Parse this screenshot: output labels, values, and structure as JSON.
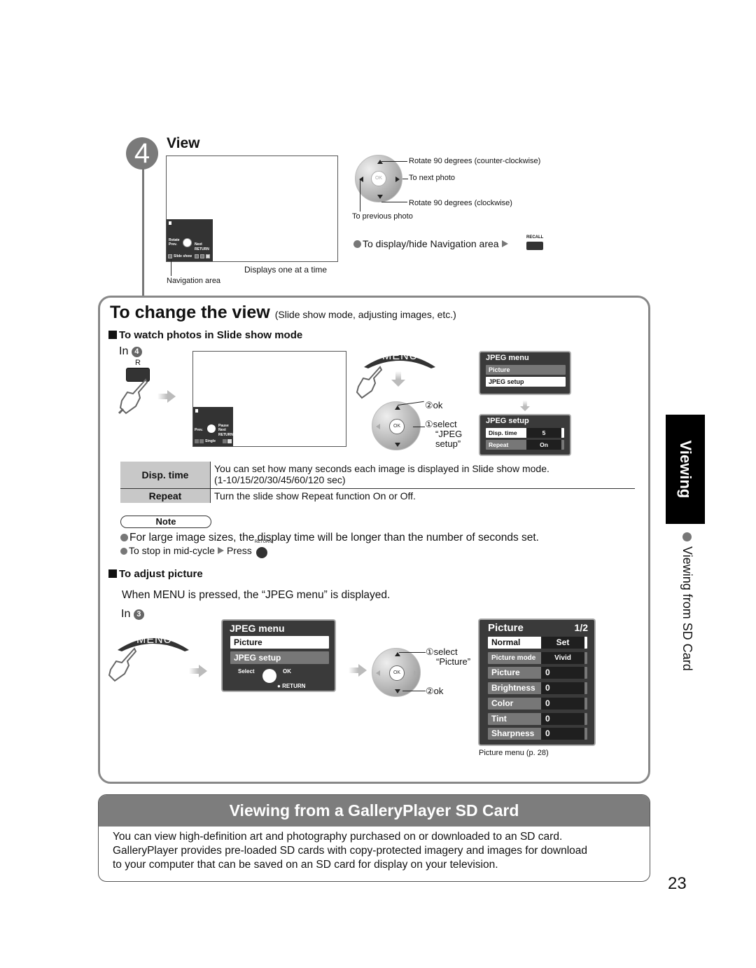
{
  "step4": {
    "number": "4",
    "title": "View",
    "screen_caption": "Displays one at a time",
    "nav_area_label": "Navigation area",
    "nav_area": {
      "rotate": "Rotate",
      "prev": "Prev.",
      "next": "Next",
      "return": "RETURN",
      "slide_show": "Slide show",
      "keys": [
        "R",
        "G",
        "B",
        "Y"
      ]
    },
    "dial": {
      "ok": "OK",
      "up_label": "Rotate 90 degrees (counter-clockwise)",
      "right_label": "To next photo",
      "down_label": "Rotate 90 degrees (clockwise)",
      "left_label": "To previous photo"
    },
    "toggle_nav": "To display/hide Navigation area",
    "recall_label": "RECALL"
  },
  "change_view": {
    "title": "To change the view",
    "subtitle": "(Slide show mode, adjusting images, etc.)",
    "slideshow": {
      "heading": "To watch photos in Slide show mode",
      "in_step_text": "In",
      "in_step_num": "4",
      "r_key": "R",
      "nav_area": {
        "prev": "Prev.",
        "pause": "Pause",
        "next": "Next",
        "return": "RETURN",
        "single": "Single"
      },
      "menu_label": "MENU",
      "dial_ok": "OK",
      "step2": "②ok",
      "step1_line1": "①select",
      "step1_line2": "“JPEG",
      "step1_line3": "setup”",
      "jpeg_menu": {
        "title": "JPEG menu",
        "items": [
          "Picture",
          "JPEG setup"
        ]
      },
      "jpeg_setup": {
        "title": "JPEG setup",
        "rows": [
          {
            "label": "Disp. time",
            "value": "5"
          },
          {
            "label": "Repeat",
            "value": "On"
          }
        ]
      }
    },
    "table": [
      {
        "key": "Disp. time",
        "desc_line1": "You can set how many seconds each image is displayed in Slide show mode.",
        "desc_line2": "(1-10/15/20/30/45/60/120 sec)"
      },
      {
        "key": "Repeat",
        "desc_line1": "Turn the slide show Repeat function On or Off."
      }
    ],
    "note": {
      "label": "Note",
      "line1": "For large image sizes, the display time will be longer than the number of seconds set.",
      "line2": "To stop in mid-cycle",
      "line2_press": "Press",
      "return_tag": "RETURN"
    },
    "adjust": {
      "heading": "To adjust picture",
      "intro": "When MENU is pressed, the “JPEG menu” is displayed.",
      "in_step_text": "In",
      "in_step_num": "3",
      "menu_label": "MENU",
      "jpeg_menu": {
        "title": "JPEG menu",
        "items": [
          "Picture",
          "JPEG setup"
        ],
        "select": "Select",
        "ok": "OK",
        "return": "RETURN"
      },
      "dial_ok": "OK",
      "step1_line1": "①select",
      "step1_line2": "“Picture”",
      "step2": "②ok",
      "picture_menu": {
        "title": "Picture",
        "page": "1/2",
        "rows": [
          {
            "label": "Normal",
            "value": "Set"
          },
          {
            "label": "Picture mode",
            "value": "Vivid"
          },
          {
            "label": "Picture",
            "value": "0"
          },
          {
            "label": "Brightness",
            "value": "0"
          },
          {
            "label": "Color",
            "value": "0"
          },
          {
            "label": "Tint",
            "value": "0"
          },
          {
            "label": "Sharpness",
            "value": "0"
          }
        ],
        "caption": "Picture menu (p. 28)"
      }
    }
  },
  "side": {
    "tab": "Viewing",
    "sub": "Viewing from SD Card"
  },
  "gallery": {
    "title": "Viewing from a GalleryPlayer SD Card",
    "body_line1": "You can view high-definition art and photography purchased on or downloaded to an SD card.",
    "body_line2": "GalleryPlayer provides pre-loaded SD cards with copy-protected imagery and images for download",
    "body_line3": "to your computer that can be saved on an SD card for display on your television."
  },
  "page_number": "23"
}
